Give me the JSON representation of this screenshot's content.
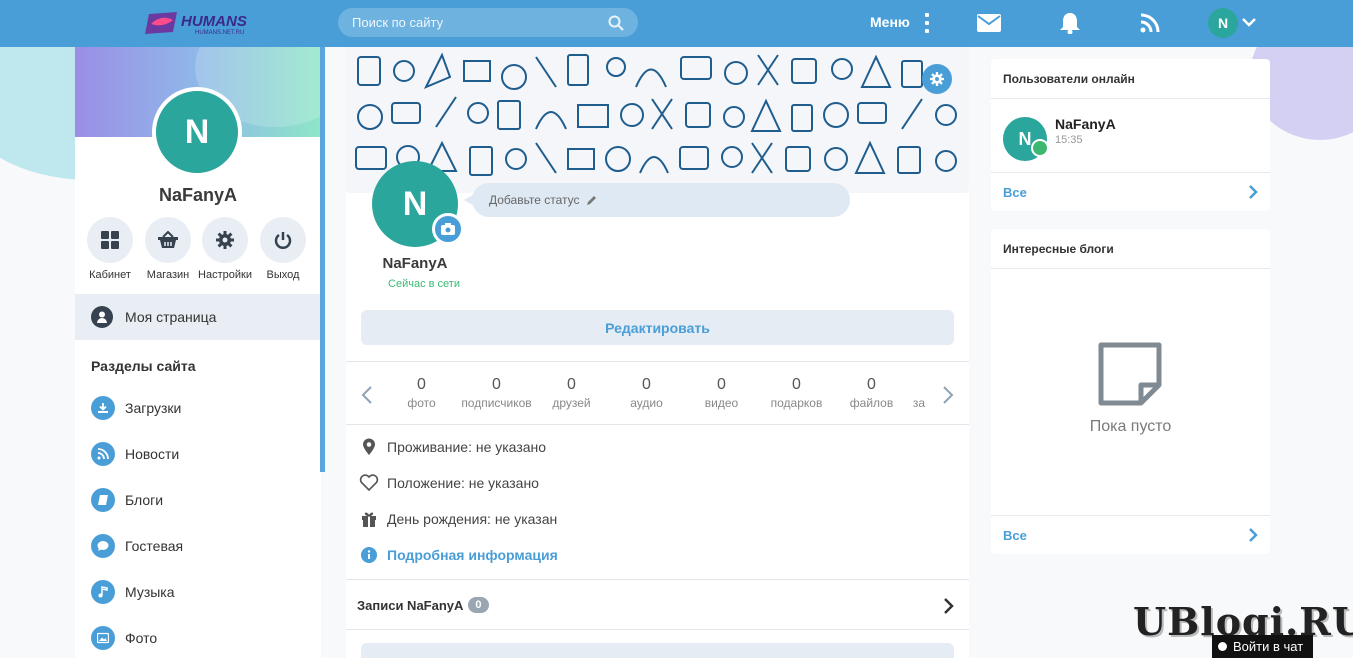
{
  "header": {
    "logo_text": "HUMANS",
    "logo_sub": "HUMANS.NET.RU",
    "search_placeholder": "Поиск по сайту",
    "menu_label": "Меню",
    "user_initial": "N"
  },
  "sidebar": {
    "avatar_initial": "N",
    "username": "NaFanyA",
    "quick_actions": [
      {
        "label": "Кабинет",
        "icon": "grid-icon"
      },
      {
        "label": "Магазин",
        "icon": "basket-icon"
      },
      {
        "label": "Настройки",
        "icon": "gear-icon"
      },
      {
        "label": "Выход",
        "icon": "power-icon"
      }
    ],
    "my_page_label": "Моя страница",
    "sections_title": "Разделы сайта",
    "items": [
      {
        "label": "Загрузки",
        "icon": "download-icon"
      },
      {
        "label": "Новости",
        "icon": "rss-icon"
      },
      {
        "label": "Блоги",
        "icon": "book-icon"
      },
      {
        "label": "Гостевая",
        "icon": "chat-icon"
      },
      {
        "label": "Музыка",
        "icon": "music-icon"
      },
      {
        "label": "Фото",
        "icon": "image-icon"
      }
    ]
  },
  "profile": {
    "avatar_initial": "N",
    "status_placeholder": "Добавьте статус",
    "name": "NaFanyA",
    "online_text": "Сейчас в сети",
    "edit_label": "Редактировать",
    "stats": [
      {
        "value": "0",
        "label": "фото"
      },
      {
        "value": "0",
        "label": "подписчиков"
      },
      {
        "value": "0",
        "label": "друзей"
      },
      {
        "value": "0",
        "label": "аудио"
      },
      {
        "value": "0",
        "label": "видео"
      },
      {
        "value": "0",
        "label": "подарков"
      },
      {
        "value": "0",
        "label": "файлов"
      },
      {
        "value": "",
        "label": "за"
      }
    ],
    "residence": "Проживание: не указано",
    "relationship": "Положение: не указано",
    "birthday": "День рождения: не указан",
    "details_link": "Подробная информация",
    "posts_label": "Записи NaFanyA",
    "posts_count": "0"
  },
  "online_users": {
    "title": "Пользователи онлайн",
    "user": {
      "initial": "N",
      "name": "NaFanyA",
      "time": "15:35"
    },
    "footer_link": "Все"
  },
  "blogs": {
    "title": "Интересные блоги",
    "empty_text": "Пока пусто",
    "footer_link": "Все"
  },
  "watermark": {
    "text": "UBlogi.RU"
  },
  "chat": {
    "label": "Войти в чат"
  },
  "colors": {
    "accent": "#4a9ed8",
    "avatar": "#2aa69c",
    "online": "#3cb872"
  }
}
